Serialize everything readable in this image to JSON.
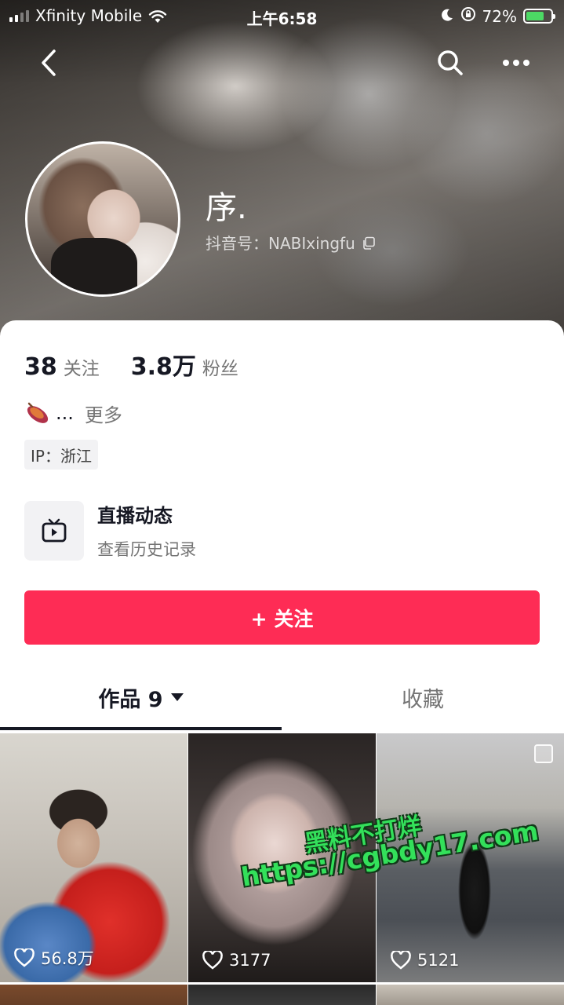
{
  "status_bar": {
    "carrier": "Xfinity Mobile",
    "time": "上午6:58",
    "battery": "72%",
    "battery_level": 0.72
  },
  "profile": {
    "nickname": "序.",
    "douyin_id": "抖音号：NABIxingfu"
  },
  "stats": {
    "following_count": "38",
    "following_label": "关注",
    "followers_count": "3.8万",
    "followers_label": "粉丝"
  },
  "bio": {
    "text": "...",
    "more": "更多",
    "emoji_icon": "sweet-potato-icon"
  },
  "ip": "IP：浙江",
  "live": {
    "title": "直播动态",
    "subtitle": "查看历史记录",
    "icon": "tv-icon"
  },
  "follow_button": "+ 关注",
  "tabs": {
    "works": "作品 9",
    "favorites": "收藏"
  },
  "videos": [
    {
      "likes": "56.8万"
    },
    {
      "likes": "3177"
    },
    {
      "likes": "5121"
    }
  ],
  "watermark": {
    "line1": "黑料不打烊",
    "line2": "https://cgbdy17.com"
  },
  "colors": {
    "accent": "#fe2c55",
    "watermark": "#33e05a"
  }
}
